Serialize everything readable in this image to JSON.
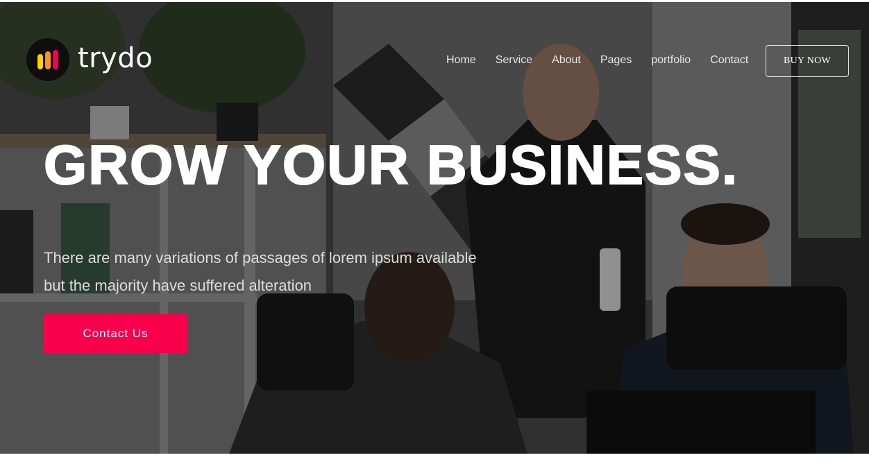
{
  "brand": {
    "name": "trydo"
  },
  "nav": {
    "items": [
      {
        "label": "Home"
      },
      {
        "label": "Service"
      },
      {
        "label": "About"
      },
      {
        "label": "Pages"
      },
      {
        "label": "portfolio"
      },
      {
        "label": "Contact"
      }
    ],
    "buy_label": "BUY NOW"
  },
  "hero": {
    "headline": "GROW YOUR BUSINESS.",
    "description_line1": "There are many variations of passages of lorem ipsum available",
    "description_line2": "but the majority have suffered alteration",
    "cta_label": "Contact Us"
  },
  "colors": {
    "accent": "#f9004d",
    "logo_bars": [
      "#f9004d",
      "#f7941d",
      "#ffd200"
    ]
  }
}
